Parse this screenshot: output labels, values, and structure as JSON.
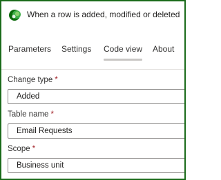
{
  "header": {
    "title": "When a row is added, modified or deleted",
    "logo_icon": "dataverse-logo-icon",
    "logo_colors": [
      "#0b6a0b",
      "#3fae49",
      "#88d16b"
    ]
  },
  "tabs": [
    {
      "label": "Parameters",
      "active": true
    },
    {
      "label": "Settings",
      "active": false
    },
    {
      "label": "Code view",
      "active": false
    },
    {
      "label": "About",
      "active": false
    }
  ],
  "fields": {
    "change_type": {
      "label": "Change type",
      "required_mark": "*",
      "value": "Added"
    },
    "table_name": {
      "label": "Table name",
      "required_mark": "*",
      "value": "Email Requests"
    },
    "scope": {
      "label": "Scope",
      "required_mark": "*",
      "value": "Business unit"
    }
  },
  "colors": {
    "frame_border": "#1a6b1a",
    "required": "#a4262c"
  }
}
